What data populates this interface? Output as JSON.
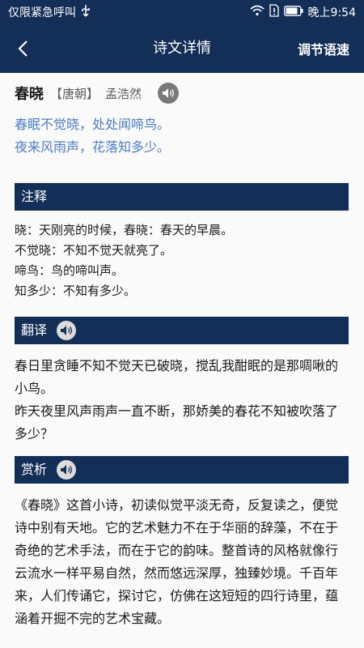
{
  "status_bar": {
    "left_text": "仅限紧急呼叫",
    "time_text": "晚上9:54",
    "icons": [
      "usb-icon",
      "wifi-icon",
      "sim-alert-icon",
      "battery-icon"
    ]
  },
  "nav": {
    "title": "诗文详情",
    "action_label": "调节语速",
    "back_icon": "chevron-left-icon"
  },
  "poem": {
    "title": "春晓",
    "dynasty": "【唐朝】",
    "author": "孟浩然",
    "lines": [
      "春眠不觉晓，处处闻啼鸟。",
      "夜来风雨声，花落知多少。"
    ]
  },
  "sections": {
    "notes": {
      "label": "注释",
      "items": [
        "晓：天刚亮的时候，春晓：春天的早晨。",
        "不觉晓：不知不觉天就亮了。",
        "啼鸟：鸟的啼叫声。",
        "知多少：不知有多少。"
      ]
    },
    "translation": {
      "label": "翻译",
      "lines": [
        "春日里贪睡不知不觉天已破晓，搅乱我酣眠的是那啁啾的小鸟。",
        "昨天夜里风声雨声一直不断，那娇美的春花不知被吹落了多少？"
      ]
    },
    "appreciation": {
      "label": "赏析",
      "text": "《春晓》这首小诗，初读似觉平淡无奇，反复读之，便觉诗中别有天地。它的艺术魅力不在于华丽的辞藻，不在于奇绝的艺术手法，而在于它的韵味。整首诗的风格就像行云流水一样平易自然，然而悠远深厚，独臻妙境。千百年来，人们传诵它，探讨它，仿佛在这短短的四行诗里，蕴涵着开掘不完的艺术宝藏。"
    }
  },
  "colors": {
    "primary": "#132f57",
    "poem_text": "#4b7cc2",
    "audio_gray": "#7a7a7a",
    "background": "#fafafa"
  }
}
